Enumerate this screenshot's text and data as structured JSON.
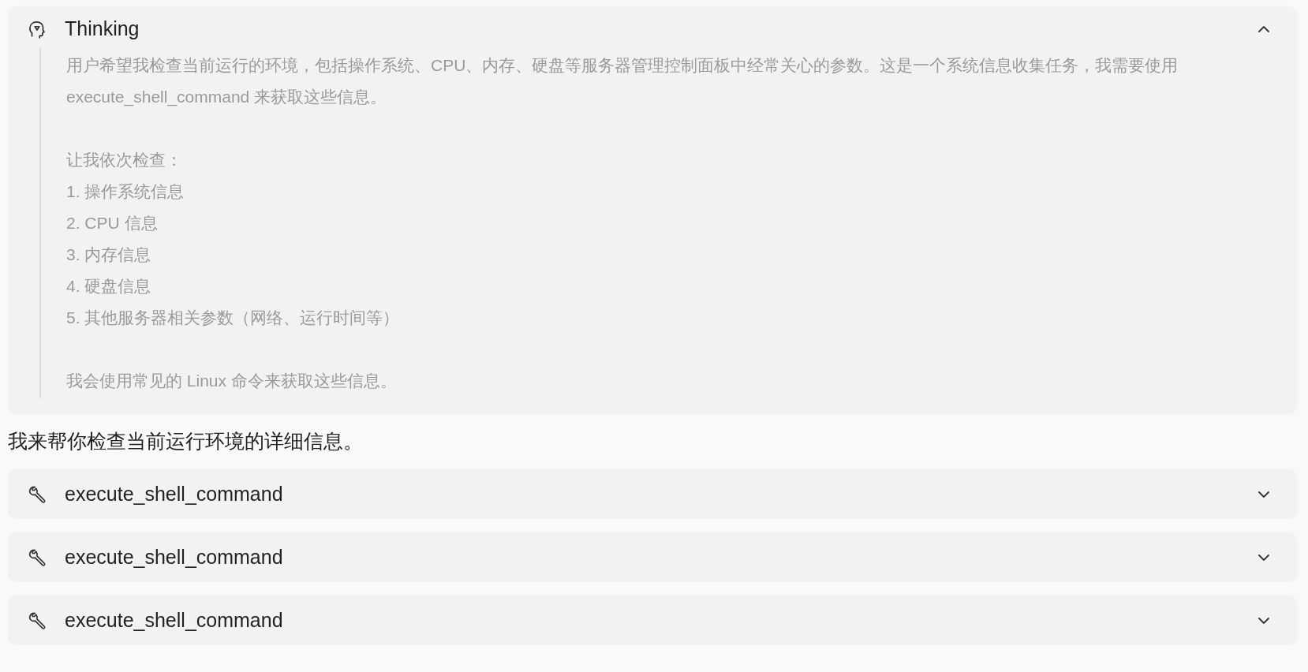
{
  "thinking": {
    "title": "Thinking",
    "expanded": true,
    "blocks": [
      {
        "kind": "paragraph",
        "text": "用户希望我检查当前运行的环境，包括操作系统、CPU、内存、硬盘等服务器管理控制面板中经常关心的参数。这是一个系统信息收集任务，我需要使用 execute_shell_command 来获取这些信息。"
      },
      {
        "kind": "list",
        "intro": "让我依次检查：",
        "items": [
          "1. 操作系统信息",
          "2. CPU 信息",
          "3. 内存信息",
          "4. 硬盘信息",
          "5. 其他服务器相关参数（网络、运行时间等）"
        ]
      },
      {
        "kind": "paragraph",
        "text": "我会使用常见的 Linux 命令来获取这些信息。"
      }
    ]
  },
  "reply": "我来帮你检查当前运行环境的详细信息。",
  "tool_calls": [
    {
      "name": "execute_shell_command",
      "expanded": false
    },
    {
      "name": "execute_shell_command",
      "expanded": false
    },
    {
      "name": "execute_shell_command",
      "expanded": false
    }
  ]
}
